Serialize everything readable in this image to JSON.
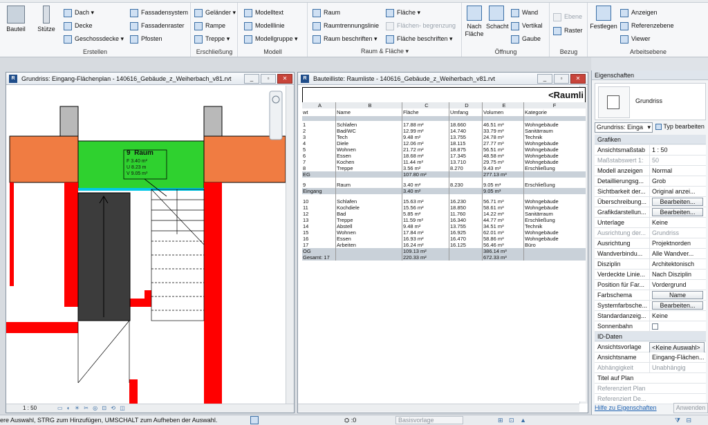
{
  "ribbon": {
    "panels": {
      "create": {
        "label": "Erstellen",
        "wall": "Bauteil",
        "column": "Stütze",
        "roof": "Dach",
        "ceiling": "Decke",
        "floor": "Geschossdecke",
        "curtain_system": "Fassadensystem",
        "curtain_grid": "Fassadenraster",
        "mullion": "Pfosten"
      },
      "circulation": {
        "label": "Erschließung",
        "railing": "Geländer",
        "ramp": "Rampe",
        "stair": "Treppe"
      },
      "model": {
        "label": "Modell",
        "model_text": "Modelltext",
        "model_line": "Modelllinie",
        "model_group": "Modellgruppe"
      },
      "room_area": {
        "label": "Raum & Fläche",
        "room": "Raum",
        "room_separator": "Raumtrennungslinie",
        "tag_room": "Raum beschriften",
        "area": "Fläche",
        "area_boundary": "Flächen- begrenzung",
        "tag_area": "Fläche beschriften"
      },
      "opening": {
        "label": "Öffnung",
        "by_face": "Nach Fläche",
        "shaft": "Schacht",
        "wall": "Wand",
        "vertical": "Vertikal",
        "dormer": "Gaube"
      },
      "datum": {
        "label": "Bezug",
        "level": "Ebene",
        "grid": "Raster"
      },
      "work_plane": {
        "label": "Arbeitsebene",
        "set": "Festlegen",
        "show": "Anzeigen",
        "ref_plane": "Referenzebene",
        "viewer": "Viewer"
      }
    }
  },
  "floorplan": {
    "title": "Grundriss: Eingang-Flächenplan - 140616_Gebäude_z_Weiherbach_v81.rvt",
    "scale": "1 : 50",
    "room_tag": {
      "number": "9",
      "name": "Raum",
      "area": "F  3.40 m²",
      "perimeter": "U  8.23 m",
      "volume": "V  9.05 m³"
    }
  },
  "schedule": {
    "title": "Bauteilliste: Raumliste - 140616_Gebäude_z_Weiherbach_v81.rvt",
    "heading": "<Raumli",
    "letters": [
      "A",
      "B",
      "C",
      "D",
      "E",
      "F"
    ],
    "columns": [
      "wt",
      "Name",
      "Fläche",
      "Umfang",
      "Volumen",
      "Kategorie"
    ],
    "groups": [
      {
        "rows": [
          [
            "1",
            "Schlafen",
            "17.88 m²",
            "18.660",
            "46.51 m³",
            "Wohngebäude"
          ],
          [
            "2",
            "Bad/WC",
            "12.99 m²",
            "14.740",
            "33.79 m³",
            "Sanitärraum"
          ],
          [
            "3",
            "Tech",
            "9.48 m²",
            "13.755",
            "24.78 m³",
            "Technik"
          ],
          [
            "4",
            "Diele",
            "12.06 m²",
            "18.115",
            "27.77 m³",
            "Wohngebäude"
          ],
          [
            "5",
            "Wohnen",
            "21.72 m²",
            "18.875",
            "56.51 m³",
            "Wohngebäude"
          ],
          [
            "6",
            "Essen",
            "18.68 m²",
            "17.345",
            "48.58 m³",
            "Wohngebäude"
          ],
          [
            "7",
            "Kochen",
            "11.44 m²",
            "13.710",
            "29.75 m³",
            "Wohngebäude"
          ],
          [
            "8",
            "Treppe",
            "3.56 m²",
            "8.270",
            "9.43 m³",
            "Erschließung"
          ]
        ],
        "footer": [
          "EG",
          "",
          "107.80 m²",
          "",
          "277.13 m³",
          ""
        ]
      },
      {
        "rows": [
          [
            "9",
            "Raum",
            "3.40 m²",
            "8.230",
            "9.05 m³",
            "Erschließung"
          ]
        ],
        "footer": [
          "Eingang",
          "",
          "3.40 m²",
          "",
          "9.05 m³",
          ""
        ]
      },
      {
        "rows": [
          [
            "10",
            "Schlafen",
            "15.63 m²",
            "16.230",
            "56.71 m³",
            "Wohngebäude"
          ],
          [
            "11",
            "Kochdiele",
            "15.56 m²",
            "18.850",
            "58.61 m³",
            "Wohngebäude"
          ],
          [
            "12",
            "Bad",
            "5.85 m²",
            "11.760",
            "14.22 m³",
            "Sanitärraum"
          ],
          [
            "13",
            "Treppe",
            "11.59 m²",
            "16.340",
            "44.77 m³",
            "Erschließung"
          ],
          [
            "14",
            "Abstell",
            "9.48 m²",
            "13.755",
            "34.51 m³",
            "Technik"
          ],
          [
            "15",
            "Wohnen",
            "17.84 m²",
            "16.925",
            "62.01 m³",
            "Wohngebäude"
          ],
          [
            "16",
            "Essen",
            "16.93 m²",
            "16.470",
            "58.86 m³",
            "Wohngebäude"
          ],
          [
            "17",
            "Arbeiten",
            "16.24 m²",
            "16.125",
            "56.46 m³",
            "Büro"
          ]
        ],
        "footer": [
          "OG",
          "",
          "109.13 m²",
          "",
          "386.14 m³",
          ""
        ]
      }
    ],
    "grand_total": [
      "Gesamt: 17",
      "",
      "220.33 m²",
      "",
      "672.33 m³",
      ""
    ]
  },
  "properties": {
    "title": "Eigenschaften",
    "type_name": "Grundriss",
    "selector": "Grundriss: Einga",
    "edit_type": "Typ bearbeiten",
    "categories": {
      "graphics": "Grafiken",
      "id_data": "ID-Daten"
    },
    "graphics_rows": [
      {
        "k": "Ansichtsmaßstab",
        "v": "1 : 50"
      },
      {
        "k": "Maßstabswert 1:",
        "v": "50"
      },
      {
        "k": "Modell anzeigen",
        "v": "Normal"
      },
      {
        "k": "Detaillierungsg...",
        "v": "Grob"
      },
      {
        "k": "Sichtbarkeit der...",
        "v": "Original anzei..."
      },
      {
        "k": "Überschreibung...",
        "v": "Bearbeiten..."
      },
      {
        "k": "Grafikdarstellun...",
        "v": "Bearbeiten..."
      },
      {
        "k": "Unterlage",
        "v": "Keine"
      },
      {
        "k": "Ausrichtung der...",
        "v": "Grundriss"
      },
      {
        "k": "Ausrichtung",
        "v": "Projektnorden"
      },
      {
        "k": "Wandverbindu...",
        "v": "Alle Wandver..."
      },
      {
        "k": "Disziplin",
        "v": "Architektonisch"
      },
      {
        "k": "Verdeckte Linie...",
        "v": "Nach Disziplin"
      },
      {
        "k": "Position für Far...",
        "v": "Vordergrund"
      },
      {
        "k": "Farbschema",
        "v": "Name"
      },
      {
        "k": "Systemfarbsche...",
        "v": "Bearbeiten..."
      },
      {
        "k": "Standardanzeig...",
        "v": "Keine"
      },
      {
        "k": "Sonnenbahn",
        "v": ""
      }
    ],
    "id_rows": [
      {
        "k": "Ansichtsvorlage",
        "v": "<Keine Auswahl>"
      },
      {
        "k": "Ansichtsname",
        "v": "Eingang-Flächen..."
      },
      {
        "k": "Abhängigkeit",
        "v": "Unabhängig"
      },
      {
        "k": "Titel auf Plan",
        "v": ""
      },
      {
        "k": "Referenziert Plan",
        "v": ""
      },
      {
        "k": "Referenziert De...",
        "v": ""
      }
    ],
    "help_link": "Hilfe zu Eigenschaften",
    "apply": "Anwenden"
  },
  "status": {
    "text": "ere Auswahl, STRG zum Hinzufügen, UMSCHALT zum Aufheben der Auswahl.",
    "zero": ":0",
    "base_template": "Basisvorlage"
  }
}
